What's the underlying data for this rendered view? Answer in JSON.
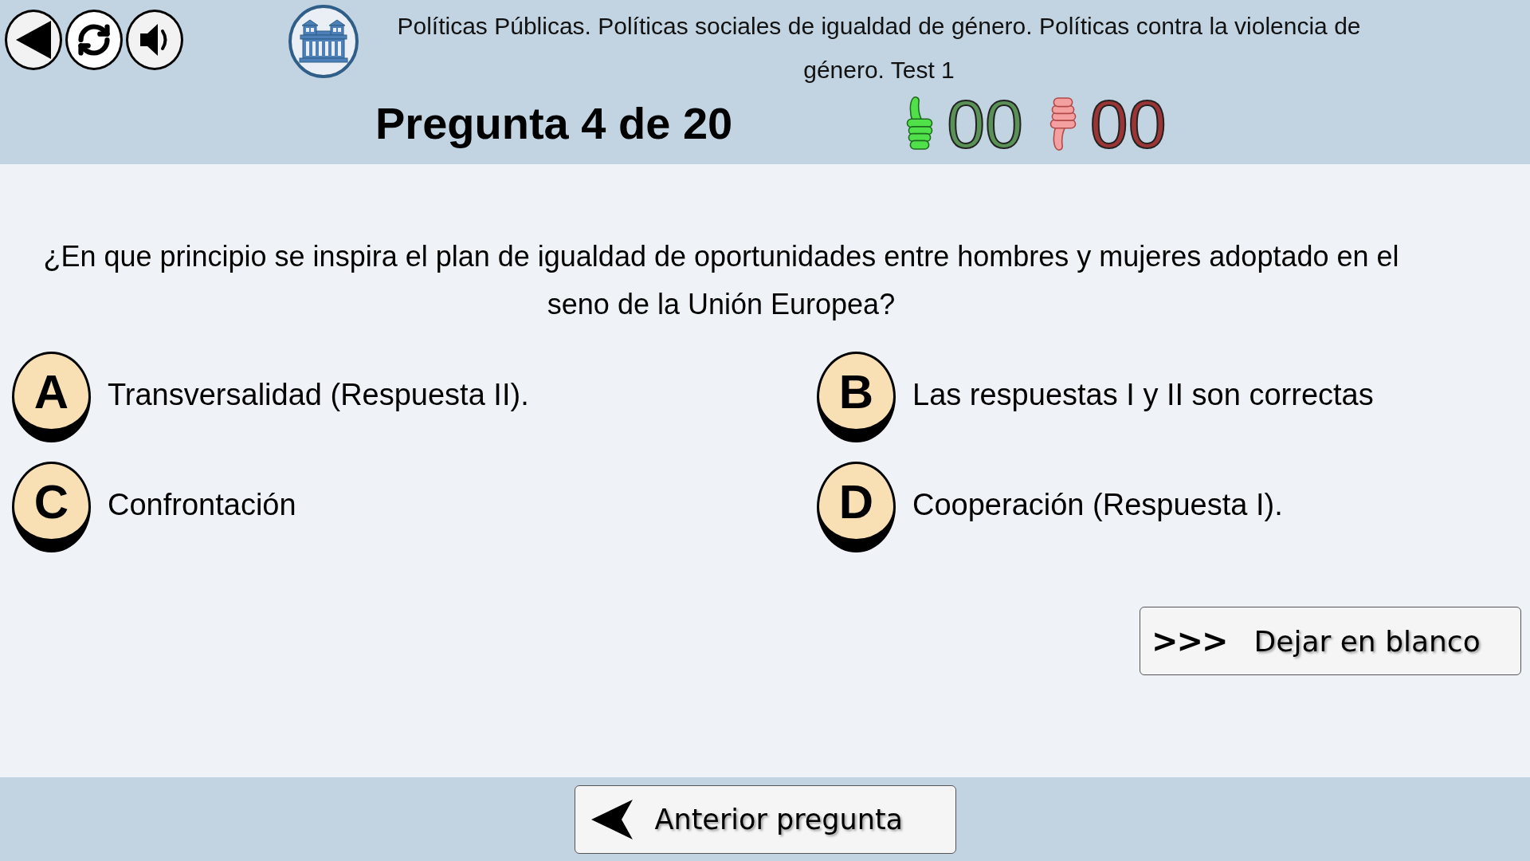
{
  "header": {
    "title": "Políticas Públicas. Políticas sociales de igualdad de género. Políticas contra la violencia de género. Test 1",
    "question_counter": "Pregunta 4 de 20",
    "score": {
      "correct": "00",
      "wrong": "00"
    }
  },
  "question": {
    "text": "¿En que principio se inspira el plan de igualdad de oportunidades entre hombres y mujeres adoptado en el seno de la Unión Europea?",
    "options": [
      {
        "letter": "A",
        "text": "Transversalidad (Respuesta II)."
      },
      {
        "letter": "B",
        "text": "Las respuestas I y II son correctas"
      },
      {
        "letter": "C",
        "text": "Confrontación"
      },
      {
        "letter": "D",
        "text": "Cooperación (Respuesta I)."
      }
    ]
  },
  "skip_button": {
    "arrows": ">>>",
    "label": "Dejar en blanco"
  },
  "footer": {
    "previous_button": "Anterior pregunta"
  }
}
